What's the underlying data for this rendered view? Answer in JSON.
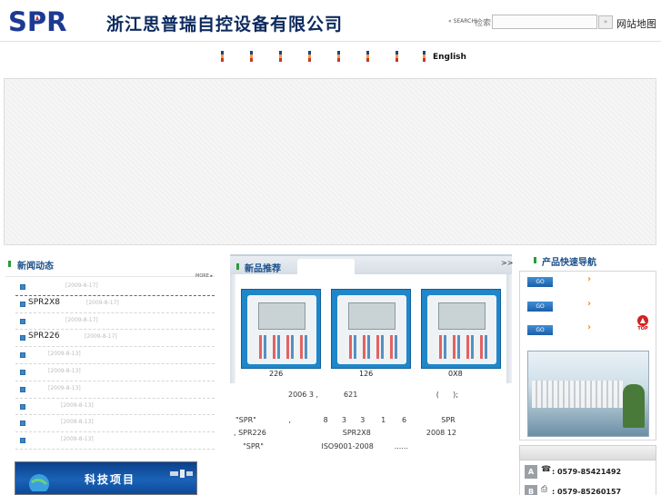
{
  "header": {
    "logo_text": "SPR",
    "company_name": "浙江思普瑞自控设备有限公司",
    "search_label": "« SEARCH",
    "search_word": "检索",
    "search_value": "",
    "search_button": "»",
    "sitemap": "网站地图"
  },
  "nav": {
    "english": "English",
    "colors": [
      "#1f3f8f",
      "#f0a020",
      "#d03030"
    ]
  },
  "news": {
    "title": "新闻动态",
    "more": "MORE ▸",
    "items": [
      {
        "title": "",
        "date": "[2009-8-17]"
      },
      {
        "title": "SPR2X8",
        "date": "[2009-8-17]"
      },
      {
        "title": "",
        "date": "[2009-8-17]"
      },
      {
        "title": "SPR226",
        "date": "[2009-8-17]"
      },
      {
        "title": "",
        "date": "[2009-8-13]"
      },
      {
        "title": "",
        "date": "[2009-8-13]"
      },
      {
        "title": "",
        "date": "[2009-8-13]"
      },
      {
        "title": "",
        "date": "[2009-8-13]"
      },
      {
        "title": "",
        "date": "[2009-8-13]"
      },
      {
        "title": "",
        "date": "[2009-8-13]"
      }
    ],
    "tech_banner": "科技项目"
  },
  "products": {
    "title": "新品推荐",
    "arrows": ">>",
    "items": [
      {
        "name": "226"
      },
      {
        "name": "126"
      },
      {
        "name": "0X8"
      }
    ],
    "intro_1": "2006 3 ,           621                                  (      );",
    "intro_2": "\"SPR\"              ,              8      3      3       1       6               SPR",
    "intro_3": ", SPR226                                 SPR2X8                        2008 12",
    "intro_4": "  \"SPR\"                         ISO9001-2008         ......"
  },
  "quicknav": {
    "title": "产品快速导航",
    "go_labels": [
      "GO",
      "GO",
      "GO"
    ],
    "top_label": "TOP"
  },
  "contact": {
    "rows": [
      {
        "badge": "A",
        "icon": "☎",
        "phone": ": 0579-85421492"
      },
      {
        "badge": "B",
        "icon": "⎙",
        "phone": ": 0579-85260157"
      }
    ]
  }
}
